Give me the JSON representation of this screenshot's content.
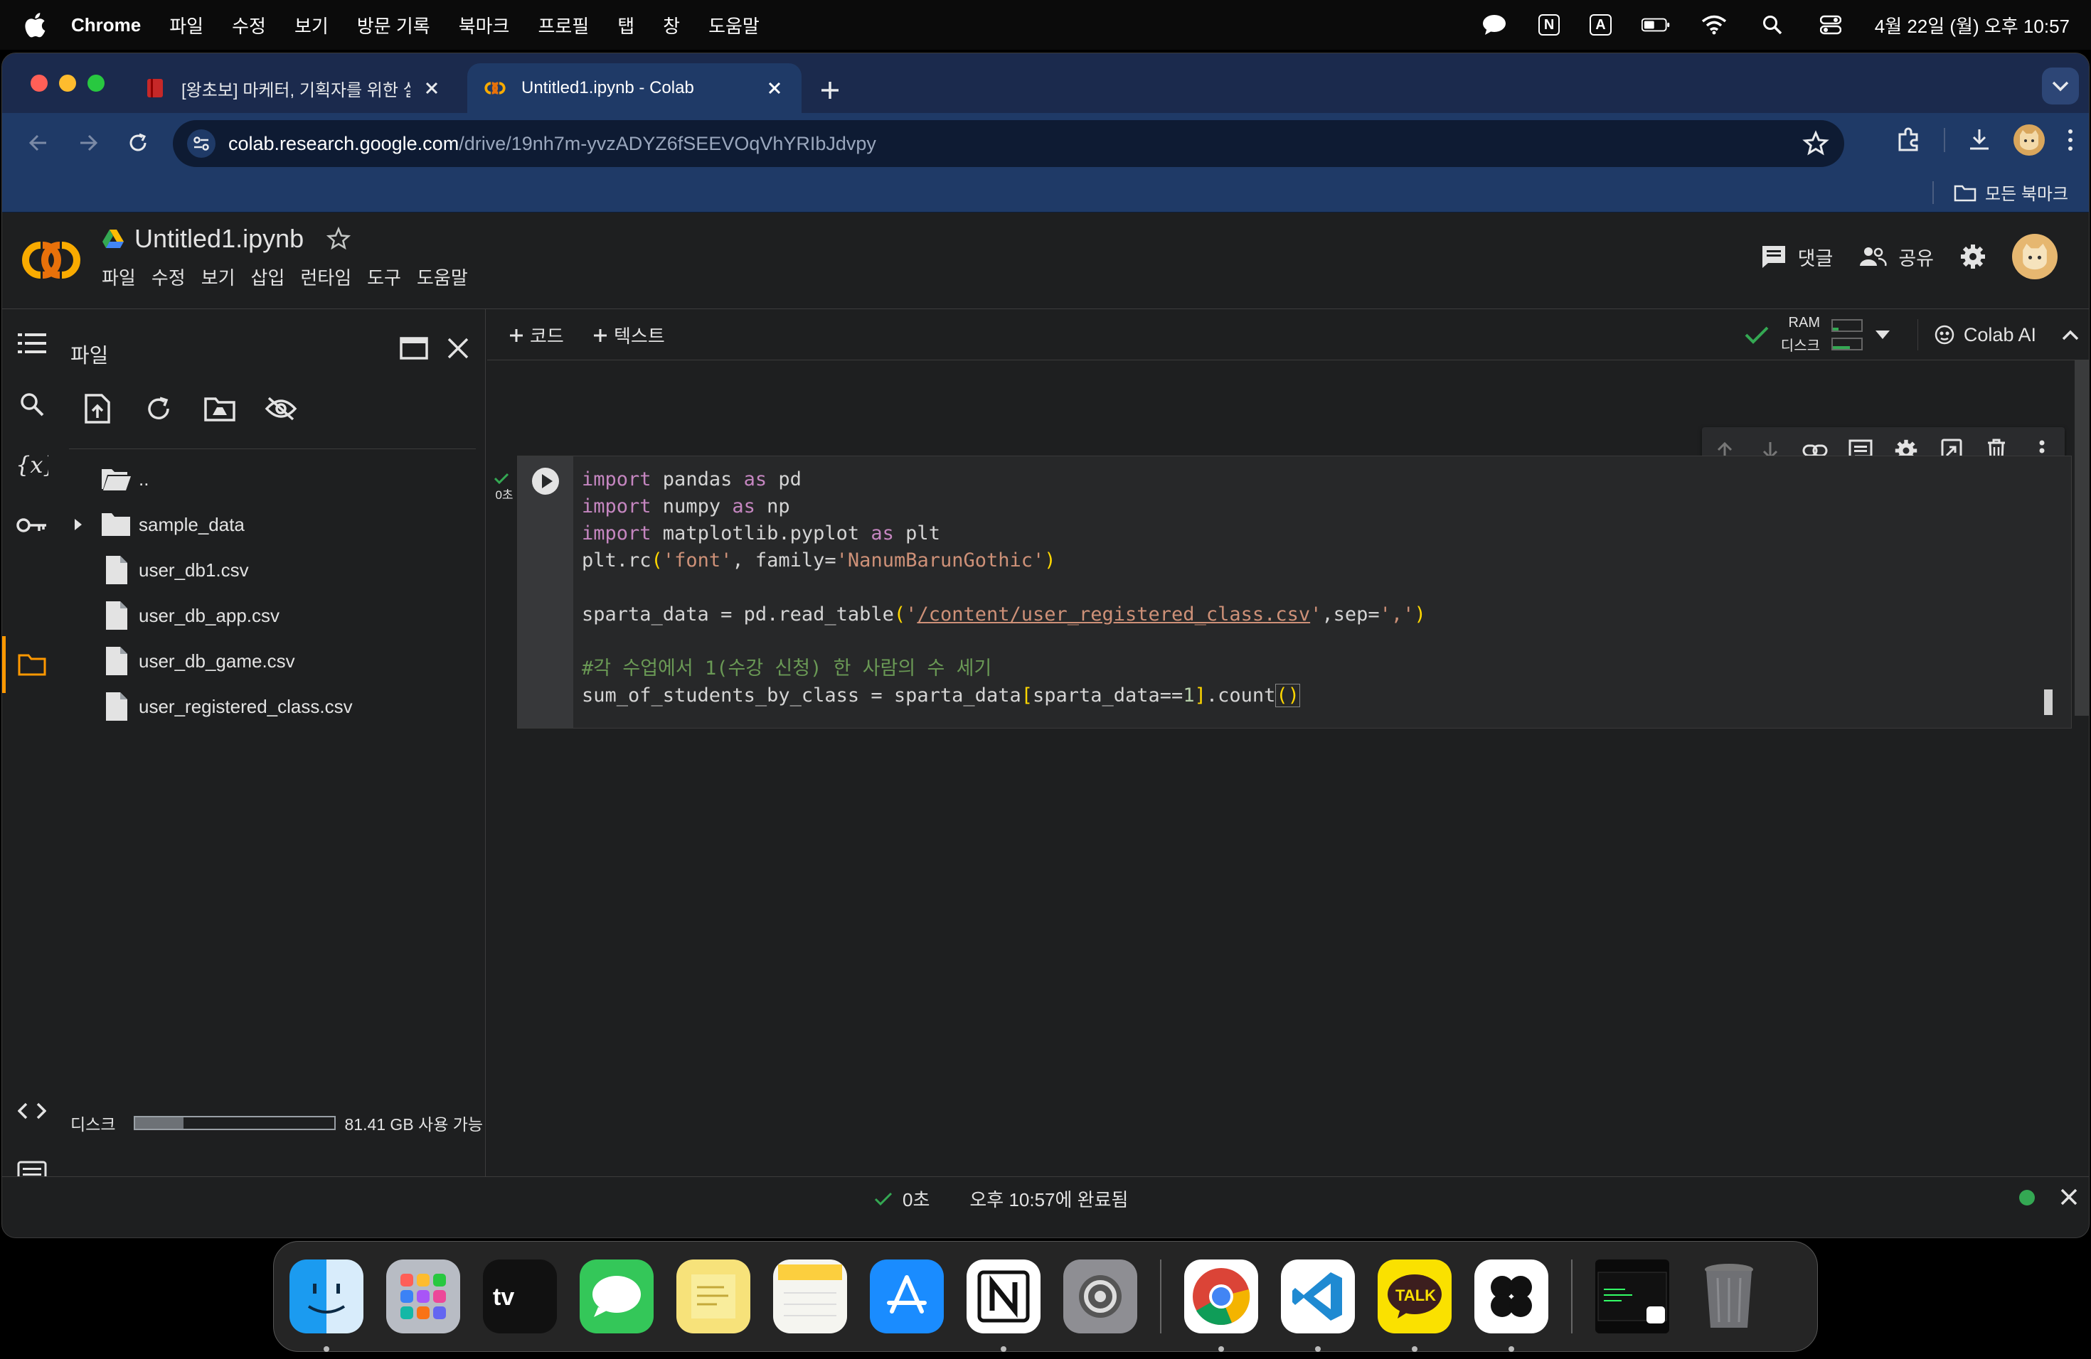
{
  "menubar": {
    "app": "Chrome",
    "items": [
      "파일",
      "수정",
      "보기",
      "방문 기록",
      "북마크",
      "프로필",
      "탭",
      "창",
      "도움말"
    ],
    "input_indicator_1": "N",
    "input_indicator_2": "A",
    "clock": "4월 22일 (월) 오후 10:57"
  },
  "browser": {
    "tabs": [
      {
        "title": "[왕초보] 마케터, 기획자를 위한 실전"
      },
      {
        "title": "Untitled1.ipynb - Colab"
      }
    ],
    "url_host": "colab.research.google.com",
    "url_path": "/drive/19nh7m-yvzADYZ6fSEEVOqVhYRIbJdvpy",
    "all_bookmarks": "모든 북마크"
  },
  "colab": {
    "notebook_title": "Untitled1.ipynb",
    "menu": [
      "파일",
      "수정",
      "보기",
      "삽입",
      "런타임",
      "도구",
      "도움말"
    ],
    "comment_label": "댓글",
    "share_label": "공유",
    "add_code": "코드",
    "add_text": "텍스트",
    "ram_label": "RAM",
    "disk_label": "디스크",
    "colab_ai": "Colab AI"
  },
  "files_panel": {
    "title": "파일",
    "entries": [
      "..",
      "sample_data",
      "user_db1.csv",
      "user_db_app.csv",
      "user_db_game.csv",
      "user_registered_class.csv"
    ],
    "disk_label": "디스크",
    "disk_free": "81.41 GB 사용 가능",
    "disk_used_fraction": 0.24
  },
  "cell": {
    "exec_time": "0초",
    "lines": [
      "import pandas as pd",
      "import numpy as np",
      "import matplotlib.pyplot as plt",
      "plt.rc('font', family='NanumBarunGothic')",
      "",
      "sparta_data = pd.read_table('/content/user_registered_class.csv',sep=',')",
      "",
      "#각 수업에서 1(수강 신청) 한 사람의 수 세기",
      "sum_of_students_by_class = sparta_data[sparta_data==1].count()"
    ]
  },
  "status": {
    "duration": "0초",
    "completed": "오후 10:57에 완료됨"
  },
  "colors": {
    "tabstrip": "#1b2a4d",
    "toolbar": "#1f3a67",
    "colab_orange": "#f9ab00",
    "success_green": "#34a853"
  }
}
